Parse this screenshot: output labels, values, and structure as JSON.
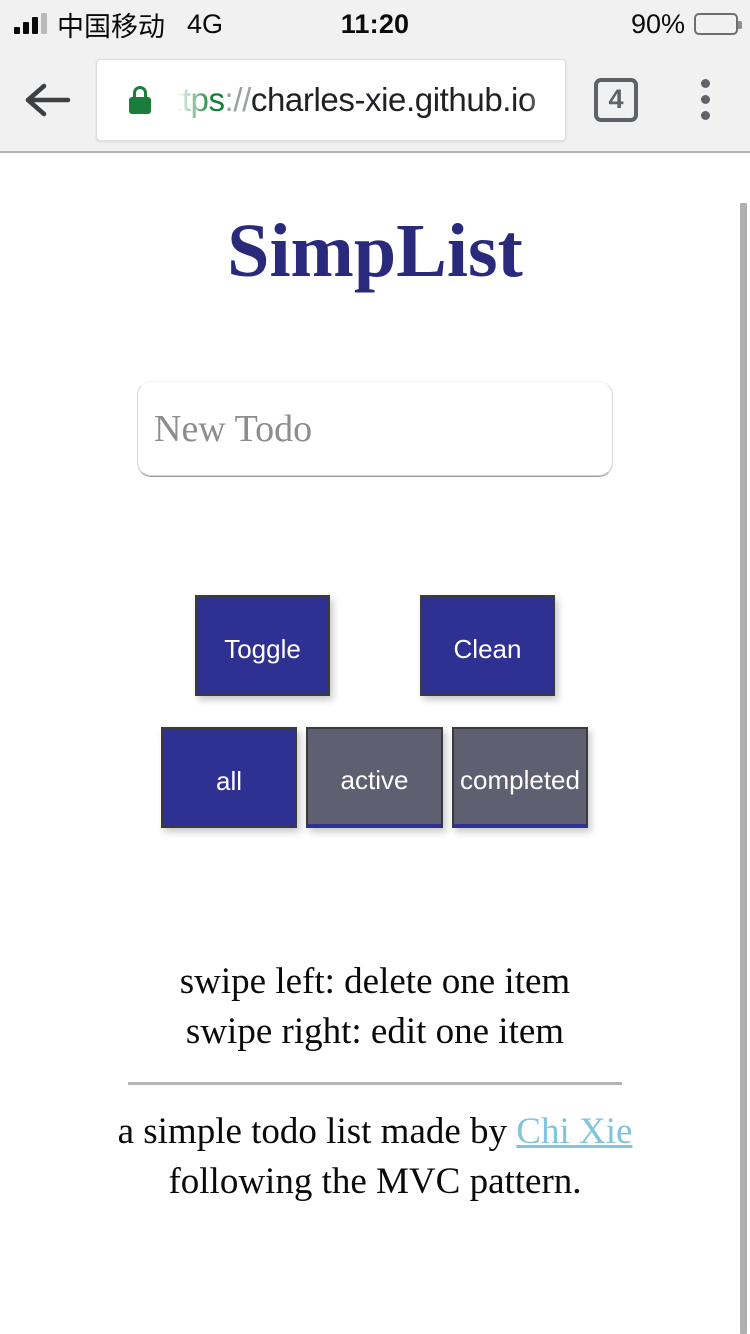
{
  "status_bar": {
    "carrier": "中国移动",
    "network": "4G",
    "time": "11:20",
    "battery_percent": "90%",
    "signal_bars_filled": 3,
    "signal_bars_total": 4,
    "battery_level": 90
  },
  "browser": {
    "back_icon": "back-arrow-icon",
    "lock_icon": "lock-icon",
    "url_scheme": "https",
    "url_separator": "://",
    "url_host": "charles-xie.github.io",
    "url_full": "https://charles-xie.github.io",
    "tab_count": "4",
    "menu_icon": "three-dot-menu-icon"
  },
  "page": {
    "title": "SimpList",
    "title_color": "#2a2a7c",
    "new_todo_placeholder": "New Todo",
    "new_todo_value": "",
    "actions": [
      {
        "id": "toggle",
        "label": "Toggle"
      },
      {
        "id": "clean",
        "label": "Clean"
      }
    ],
    "filters": [
      {
        "id": "all",
        "label": "all",
        "active": true
      },
      {
        "id": "active",
        "label": "active",
        "active": false
      },
      {
        "id": "completed",
        "label": "completed",
        "active": false
      }
    ],
    "hints": [
      "swipe left: delete one item",
      "swipe right: edit one item"
    ],
    "footer": {
      "line1_before_link": "a simple todo list made by ",
      "link_text": "Chi Xie",
      "line2": "following the MVC pattern."
    },
    "colors": {
      "accent": "#2e3192",
      "inactive_button": "#5e5f70",
      "link": "#82c4dc",
      "divider": "#b5b5b5",
      "placeholder": "#8d8d8d"
    }
  },
  "scrollbar": {
    "visible": true,
    "orientation": "vertical"
  }
}
